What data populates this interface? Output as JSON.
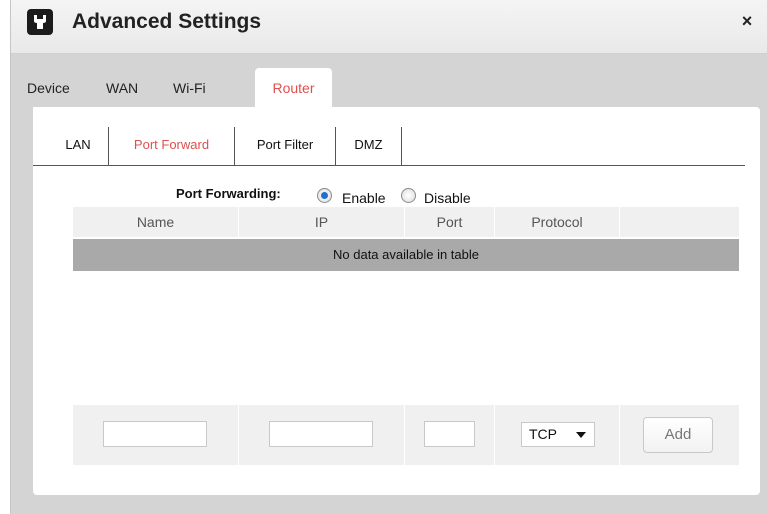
{
  "dialog": {
    "title": "Advanced Settings",
    "close_label": "×",
    "icon": "wrench-icon"
  },
  "main_tabs": [
    {
      "label": "Device",
      "active": false
    },
    {
      "label": "WAN",
      "active": false
    },
    {
      "label": "Wi-Fi",
      "active": false
    },
    {
      "label": "Router",
      "active": true
    }
  ],
  "sub_tabs": [
    {
      "label": "LAN",
      "active": false
    },
    {
      "label": "Port Forward",
      "active": true
    },
    {
      "label": "Port Filter",
      "active": false
    },
    {
      "label": "DMZ",
      "active": false
    }
  ],
  "port_forwarding": {
    "label": "Port Forwarding:",
    "options": [
      {
        "label": "Enable",
        "selected": true
      },
      {
        "label": "Disable",
        "selected": false
      }
    ]
  },
  "table": {
    "columns": [
      "Name",
      "IP",
      "Port",
      "Protocol",
      ""
    ],
    "empty_message": "No data available in table"
  },
  "add_row": {
    "name_value": "",
    "ip_value": "",
    "port_value": "",
    "protocol_selected": "TCP",
    "add_label": "Add"
  },
  "colors": {
    "accent": "#e05050",
    "radio_checked": "#1f6fd0",
    "panel_bg": "#d4d4d4"
  }
}
